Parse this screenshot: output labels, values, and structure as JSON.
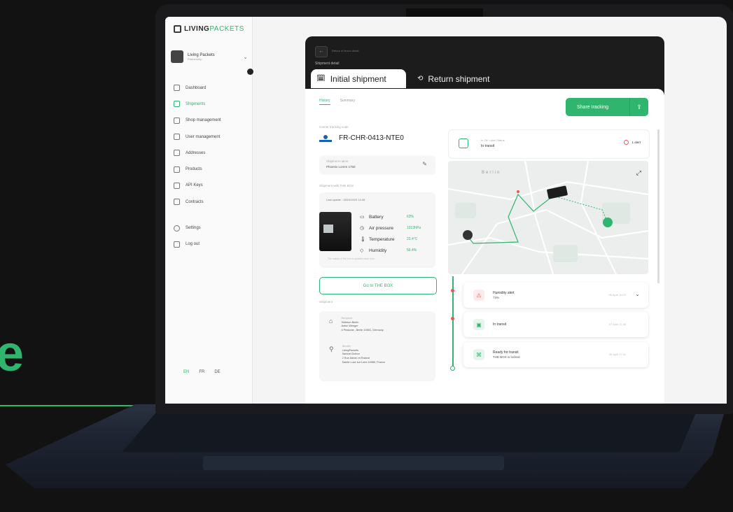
{
  "background": {
    "accent_letter": "e",
    "accent_color": "#2fb56e"
  },
  "app": {
    "logo_prefix": "LIVING",
    "logo_suffix": "PACKETS",
    "org_name": "Living Packets",
    "org_role": "Partnership"
  },
  "sidebar": {
    "items": [
      {
        "label": "Dashboard",
        "icon": "dashboard-icon"
      },
      {
        "label": "Shipments",
        "icon": "shipments-icon",
        "active": true
      },
      {
        "label": "Shop management",
        "icon": "shop-icon"
      },
      {
        "label": "User management",
        "icon": "users-icon"
      },
      {
        "label": "Addresses",
        "icon": "address-icon"
      },
      {
        "label": "Products",
        "icon": "products-icon"
      },
      {
        "label": "API Keys",
        "icon": "key-icon"
      },
      {
        "label": "Contracts",
        "icon": "contract-icon"
      }
    ],
    "bottom_items": [
      {
        "label": "Settings",
        "icon": "gear-icon"
      },
      {
        "label": "Log out",
        "icon": "logout-icon"
      }
    ],
    "languages": [
      "EN",
      "FR",
      "DE"
    ]
  },
  "header": {
    "breadcrumb": "Retour à l'envoi detail",
    "title": "Shipment detail",
    "tabs": [
      {
        "label": "Initial shipment",
        "active": true
      },
      {
        "label": "Return shipment",
        "active": false
      }
    ]
  },
  "content": {
    "subtabs": [
      "History",
      "Summary"
    ],
    "share_button": "Share tracking",
    "tracking_label": "Carrier tracking code",
    "tracking_code": "FR-CHR-0413-NTE0",
    "shipment_name_label": "Shipment name",
    "shipment_name_value": "Phoenix Lorem 1750",
    "box_section_label": "Shipment with THE BOX",
    "last_update": "Last update : 18/10/2023 12:45",
    "sensors": [
      {
        "label": "Battery",
        "value": "63%",
        "icon": "battery-icon"
      },
      {
        "label": "Air pressure",
        "value": "1013hPa",
        "icon": "pressure-icon"
      },
      {
        "label": "Temperature",
        "value": "23.4°C",
        "icon": "thermometer-icon"
      },
      {
        "label": "Humidity",
        "value": "56.4%",
        "icon": "droplet-icon"
      }
    ],
    "box_note": "The values of the box is updated each hour",
    "goto_button": "Go to THE BOX",
    "parties_label": "Shipment",
    "recipient": {
      "title": "Recipient",
      "lines": [
        "Tekleum Berlin",
        "Anton Wenger",
        "4 Pindorstr., Berlin 10551, Germany"
      ]
    },
    "sender": {
      "title": "Sender",
      "lines": [
        "LivingPackets",
        "Samuel Dufour",
        "2 Rue Adrien et Roland",
        "Sainte Luce sur Loire 44980, France"
      ]
    },
    "status": {
      "caption": "In OK Label Status",
      "value": "In transit",
      "alert": "1 alert"
    },
    "map": {
      "city_label": "Berlin"
    },
    "events": [
      {
        "title": "Humidity alert",
        "sub": "73%",
        "date": "08 April 10:02",
        "icon": "humidity-alert-icon"
      },
      {
        "title": "In transit",
        "sub": "",
        "date": "07 April 11:48",
        "icon": "transit-icon"
      },
      {
        "title": "Ready for transit",
        "sub": "THE BOX is locked",
        "date": "06 April 17:11",
        "icon": "lock-icon"
      }
    ]
  }
}
